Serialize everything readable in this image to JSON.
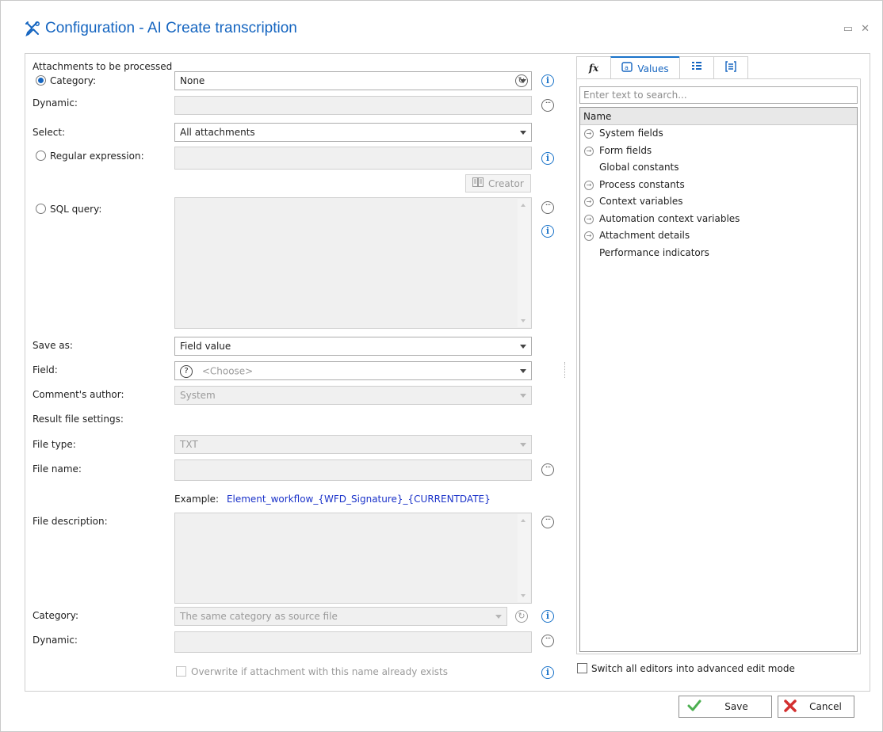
{
  "window": {
    "title": "Configuration - AI Create transcription",
    "maximize_glyph": "▭",
    "close_glyph": "✕"
  },
  "form": {
    "section_attachments": "Attachments to be processed",
    "category_label": "Category:",
    "category_value": "None",
    "dynamic_label": "Dynamic:",
    "select_label": "Select:",
    "select_value": "All attachments",
    "regex_label": "Regular expression:",
    "creator_label": "Creator",
    "sql_label": "SQL query:",
    "save_as_label": "Save as:",
    "save_as_value": "Field value",
    "field_label": "Field:",
    "field_placeholder": "<Choose>",
    "comment_author_label": "Comment's author:",
    "comment_author_value": "System",
    "result_settings_label": "Result file settings:",
    "file_type_label": "File type:",
    "file_type_value": "TXT",
    "file_name_label": "File name:",
    "example_label": "Example:",
    "example_value": "Element_workflow_{WFD_Signature}_{CURRENTDATE}",
    "file_desc_label": "File description:",
    "category2_label": "Category:",
    "category2_value": "The same category as source file",
    "dynamic2_label": "Dynamic:",
    "overwrite_label": "Overwrite if attachment with this name already exists"
  },
  "right_panel": {
    "tabs": [
      {
        "label": "",
        "icon": "fx-icon"
      },
      {
        "label": "Values",
        "icon": "values-icon"
      },
      {
        "label": "",
        "icon": "list-icon"
      },
      {
        "label": "",
        "icon": "form-icon"
      }
    ],
    "search_placeholder": "Enter text to search...",
    "tree_header": "Name",
    "tree_items": [
      {
        "label": "System fields",
        "expandable": true
      },
      {
        "label": "Form fields",
        "expandable": true
      },
      {
        "label": "Global constants",
        "expandable": false
      },
      {
        "label": "Process constants",
        "expandable": true
      },
      {
        "label": "Context variables",
        "expandable": true
      },
      {
        "label": "Automation context variables",
        "expandable": true
      },
      {
        "label": "Attachment details",
        "expandable": true
      },
      {
        "label": "Performance indicators",
        "expandable": false
      }
    ],
    "advanced_mode_label": "Switch all editors into advanced edit mode"
  },
  "footer": {
    "save_label": "Save",
    "cancel_label": "Cancel"
  },
  "colors": {
    "accent": "#1565c0",
    "link": "#1a32c9",
    "save_check": "#4caf50",
    "cancel_x": "#d32f2f"
  }
}
